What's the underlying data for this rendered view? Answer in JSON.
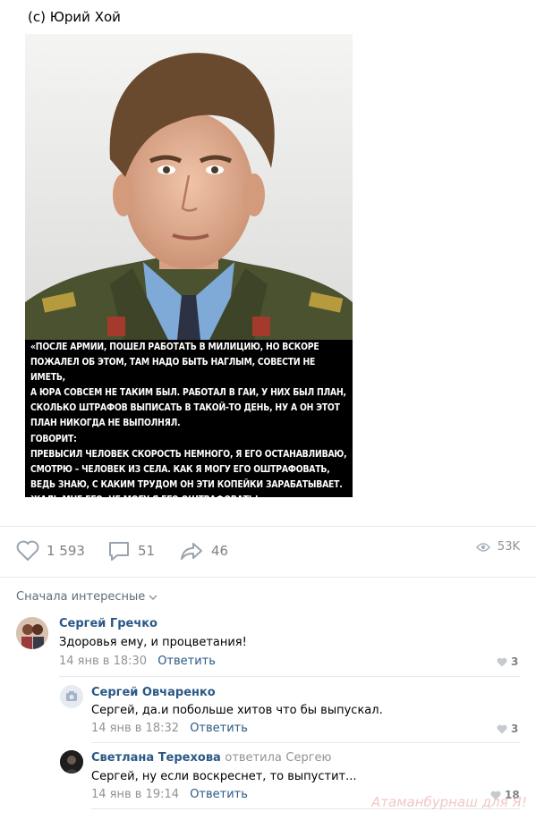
{
  "post": {
    "caption": "(с) Юрий Хой",
    "image_text": "«ПОСЛЕ АРМИИ, ПОШЕЛ РАБОТАТЬ В МИЛИЦИЮ, НО ВСКОРЕ\nПОЖАЛЕЛ ОБ ЭТОМ, ТАМ НАДО БЫТЬ НАГЛЫМ, СОВЕСТИ НЕ ИМЕТЬ,\nА ЮРА СОВСЕМ НЕ ТАКИМ БЫЛ. РАБОТАЛ В ГАИ, У НИХ БЫЛ ПЛАН,\nСКОЛЬКО ШТРАФОВ ВЫПИСАТЬ В ТАКОЙ-ТО ДЕНЬ, НУ А ОН ЭТОТ\nПЛАН НИКОГДА НЕ ВЫПОЛНЯЛ.\nГОВОРИТ:\nПРЕВЫСИЛ ЧЕЛОВЕК СКОРОСТЬ НЕМНОГО, Я ЕГО ОСТАНАВЛИВАЮ,\nСМОТРЮ – ЧЕЛОВЕК ИЗ СЕЛА. КАК Я МОГУ ЕГО ОШТРАФОВАТЬ,\nВЕДЬ ЗНАЮ, С КАКИМ ТРУДОМ ОН ЭТИ КОПЕЙКИ ЗАРАБАТЫВАЕТ.\nЖАЛЬ МНЕ ЕГО, НЕ МОГУ Я ЕГО ОШТРАФОВАТЬ!»"
  },
  "actions": {
    "likes": "1 593",
    "comments": "51",
    "shares": "46",
    "views": "53K"
  },
  "sort_label": "Сначала интересные",
  "comments": [
    {
      "author": "Сергей Гречко",
      "text": "Здоровья ему, и процветания!",
      "date": "14 янв в 18:30",
      "reply_label": "Ответить",
      "likes": "3"
    },
    {
      "author": "Сергей Овчаренко",
      "text": "Сергей, да.и побольше хитов что бы выпускал.",
      "date": "14 янв в 18:32",
      "reply_label": "Ответить",
      "likes": "3"
    },
    {
      "author": "Светлана Терехова",
      "replied": "ответила",
      "replied_to": "Сергею",
      "text": "Сергей, ну если воскреснет, то выпустит...",
      "date": "14 янв в 19:14",
      "reply_label": "Ответить",
      "likes": "18"
    }
  ],
  "watermark": "Атаманбурнаш для Я!",
  "colors": {
    "link": "#2a5885",
    "muted": "#939393",
    "divider": "#e7e8ec"
  }
}
